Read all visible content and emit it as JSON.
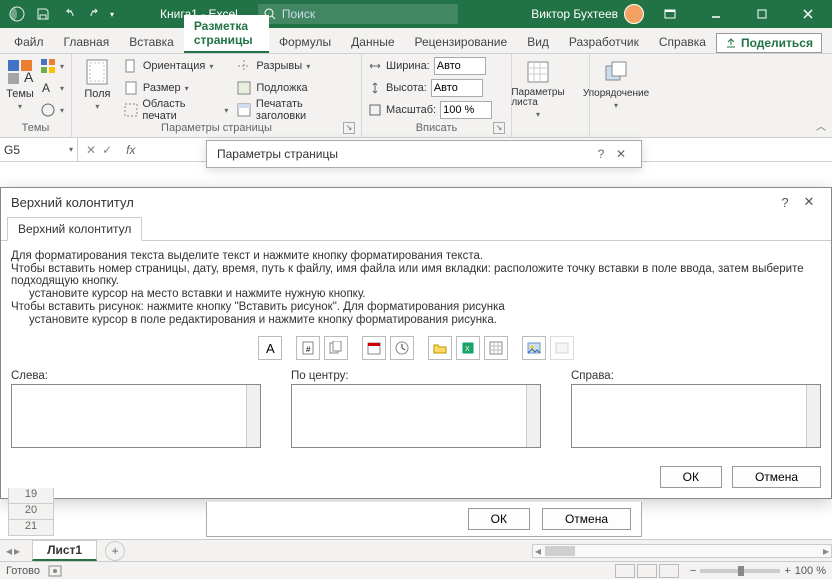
{
  "titlebar": {
    "title": "Книга1  -  Excel",
    "search_placeholder": "Поиск",
    "user": "Виктор Бухтеев"
  },
  "tabs": {
    "items": [
      "Файл",
      "Главная",
      "Вставка",
      "Разметка страницы",
      "Формулы",
      "Данные",
      "Рецензирование",
      "Вид",
      "Разработчик",
      "Справка"
    ],
    "active_index": 3,
    "share": "Поделиться"
  },
  "ribbon": {
    "themes": {
      "big": "Темы",
      "group": "Темы"
    },
    "margins": {
      "big": "Поля"
    },
    "page_setup": {
      "orientation": "Ориентация",
      "size": "Размер",
      "print_area": "Область печати",
      "breaks": "Разрывы",
      "background": "Подложка",
      "print_titles": "Печатать заголовки",
      "group": "Параметры страницы"
    },
    "fit": {
      "width_label": "Ширина:",
      "width_val": "Авто",
      "height_label": "Высота:",
      "height_val": "Авто",
      "scale_label": "Масштаб:",
      "scale_val": "100 %",
      "group": "Вписать"
    },
    "sheet_opts": {
      "big": "Параметры листа"
    },
    "arrange": {
      "big": "Упорядочение"
    }
  },
  "formula_bar": {
    "cell": "G5"
  },
  "ps_dialog": {
    "title": "Параметры страницы",
    "ok": "ОК",
    "cancel": "Отмена"
  },
  "hf_dialog": {
    "title": "Верхний колонтитул",
    "tab": "Верхний колонтитул",
    "p1": "Для форматирования текста выделите текст и нажмите кнопку форматирования текста.",
    "p2": "Чтобы вставить номер страницы, дату, время, путь к файлу, имя файла или имя вкладки: расположите точку вставки в поле ввода, затем выберите подходящую кнопку.",
    "p3": "установите курсор на место вставки и нажмите нужную кнопку.",
    "p4": "Чтобы вставить рисунок: нажмите кнопку \"Вставить рисунок\". Для форматирования рисунка",
    "p5": "установите курсор в поле редактирования и нажмите кнопку форматирования рисунка.",
    "left": "Слева:",
    "center": "По центру:",
    "right": "Справа:",
    "ok": "ОК",
    "cancel": "Отмена"
  },
  "sheet": {
    "rows": [
      "19",
      "20",
      "21"
    ],
    "tab": "Лист1"
  },
  "status": {
    "ready": "Готово",
    "zoom": "100 %",
    "minus": "−",
    "plus": "+"
  }
}
